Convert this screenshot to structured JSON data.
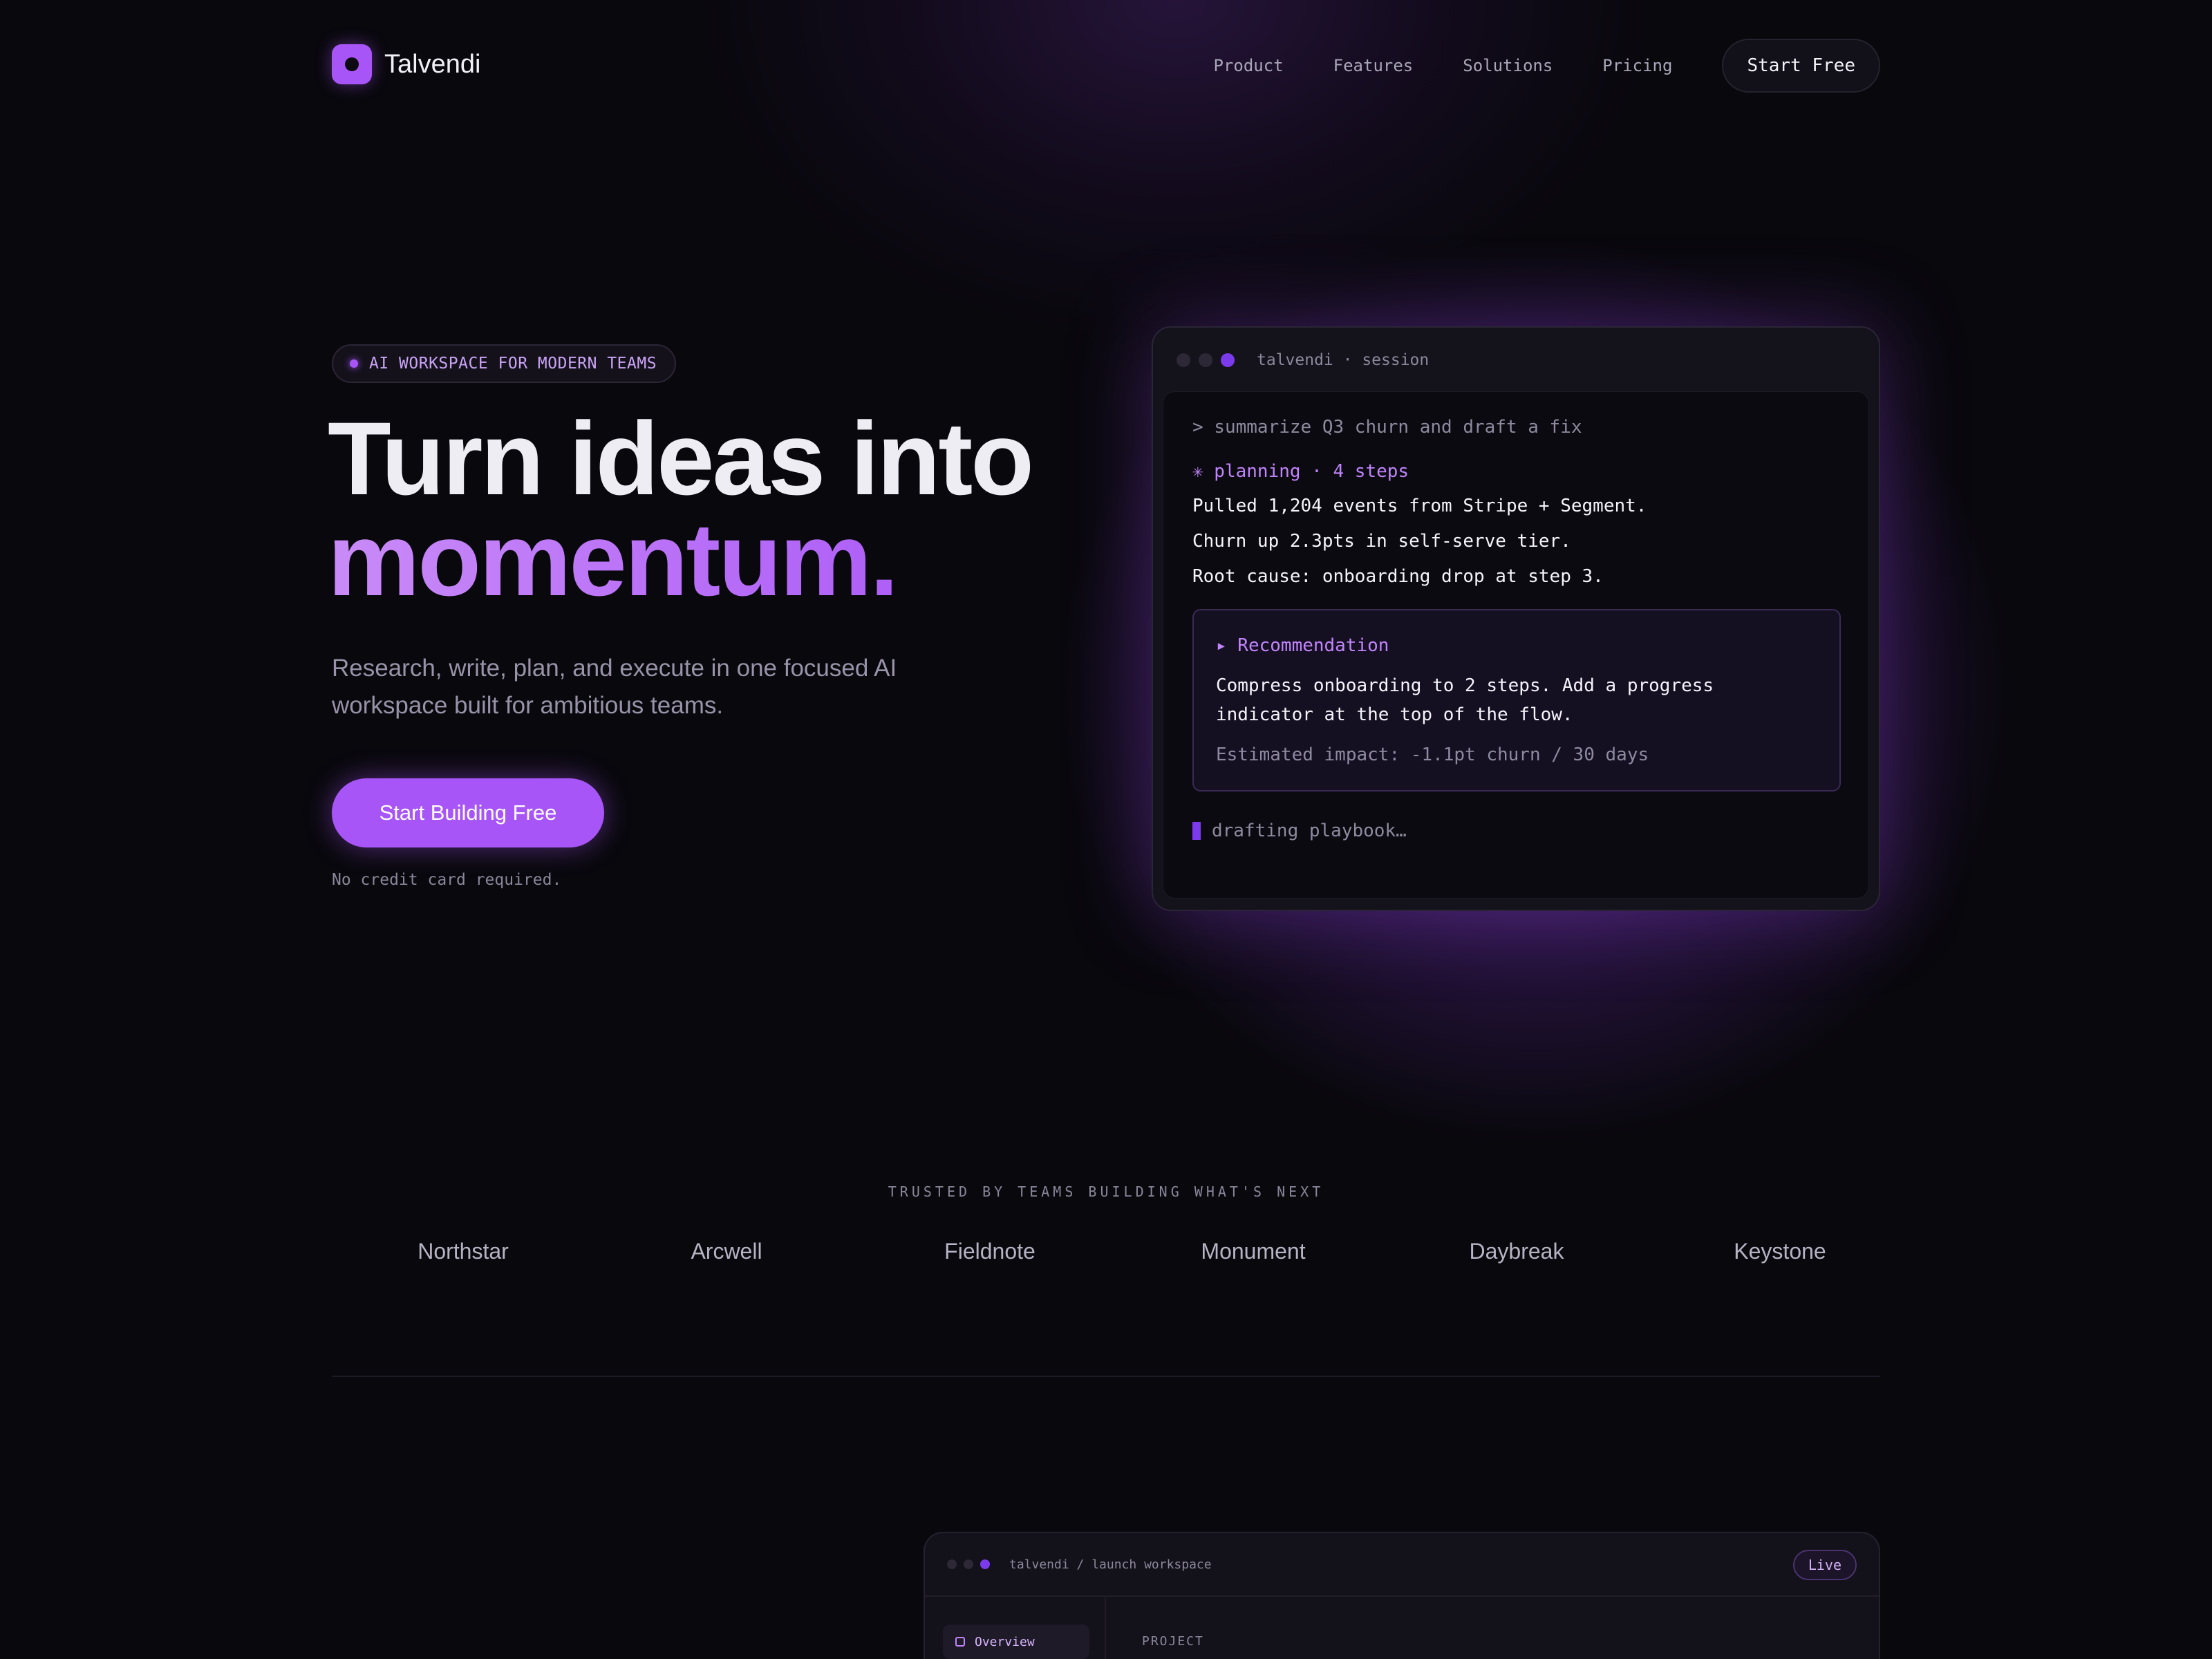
{
  "nav": {
    "brand": "Talvendi",
    "links": [
      "Product",
      "Features",
      "Solutions",
      "Pricing"
    ],
    "cta": "Start Free"
  },
  "hero": {
    "badge": "AI WORKSPACE FOR MODERN TEAMS",
    "headline_line1": "Turn ideas into",
    "headline_line2": "momentum.",
    "subhead": "Research, write, plan, and execute in one focused AI workspace built for ambitious teams.",
    "cta": "Start Building Free",
    "note": "No credit card required."
  },
  "terminal": {
    "title": "talvendi · session",
    "prompt": "> summarize Q3 churn and draft a fix",
    "planning": "✳ planning · 4 steps",
    "output": [
      "Pulled 1,204 events from Stripe + Segment.",
      "Churn up 2.3pts in self-serve tier.",
      "Root cause: onboarding drop at step 3."
    ],
    "recommendation": {
      "heading": "▸ Recommendation",
      "text": "Compress onboarding to 2 steps. Add a progress indicator at the top of the flow.",
      "impact": "Estimated impact: -1.1pt churn / 30 days"
    },
    "status": "drafting playbook…"
  },
  "trusted": {
    "label": "TRUSTED BY TEAMS BUILDING WHAT'S NEXT",
    "logos": [
      "Northstar",
      "Arcwell",
      "Fieldnote",
      "Monument",
      "Daybreak",
      "Keystone"
    ]
  },
  "workspace": {
    "title": "talvendi / launch workspace",
    "live_badge": "Live",
    "nav_item": "Overview",
    "section_label": "PROJECT"
  },
  "colors": {
    "background": "#09080d",
    "accent": "#a855f7",
    "accent_light": "#c084fc"
  }
}
